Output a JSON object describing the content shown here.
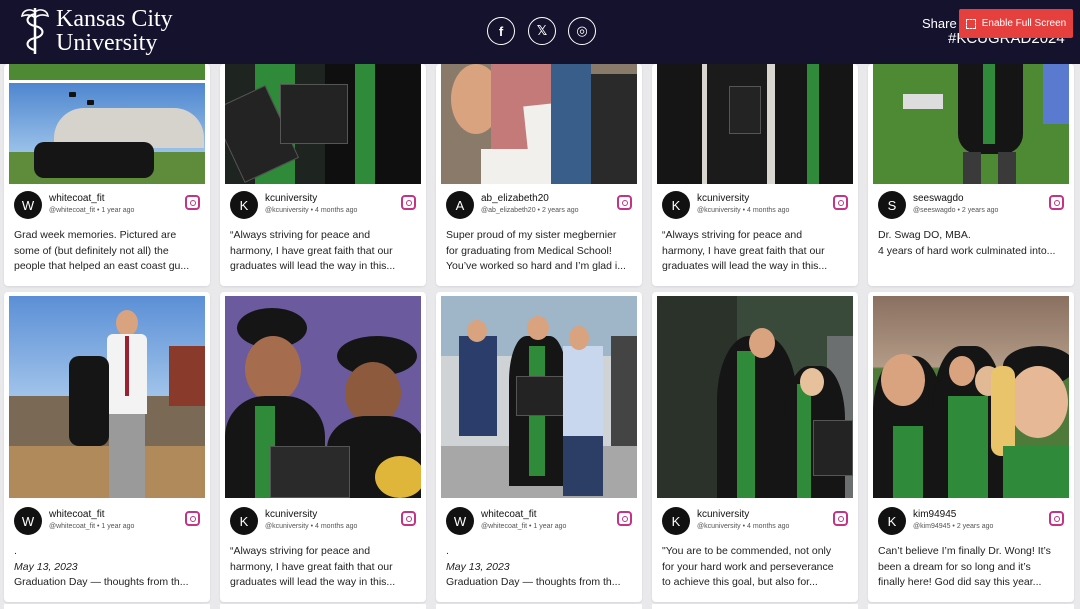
{
  "header": {
    "logo_line1": "Kansas City",
    "logo_line2": "University",
    "share_text": "Share y",
    "hashtag": "#KCUGRAD2024",
    "fullscreen_label": "Enable Full Screen",
    "social": [
      {
        "name": "facebook",
        "glyph": "f"
      },
      {
        "name": "x",
        "glyph": "𝕏"
      },
      {
        "name": "instagram",
        "glyph": "◎"
      }
    ]
  },
  "colors": {
    "header_bg": "#15122d",
    "fullscreen_btn": "#e5403e",
    "instagram": "#c13584"
  },
  "cards": [
    {
      "initial": "W",
      "username": "whitecoat_fit",
      "handle": "@whitecoat_fit",
      "time": "1 year ago",
      "caption": [
        "Grad week memories. Pictured are",
        "some of (but definitely not all) the",
        "people that helped an east coast gu..."
      ]
    },
    {
      "initial": "K",
      "username": "kcuniversity",
      "handle": "@kcuniversity",
      "time": "4 months ago",
      "caption": [
        "“Always striving for peace and",
        "harmony, I have great faith that our",
        "graduates will lead the way in this..."
      ]
    },
    {
      "initial": "A",
      "username": "ab_elizabeth20",
      "handle": "@ab_elizabeth20",
      "time": "2 years ago",
      "caption": [
        "Super proud of my sister megbernier",
        "for graduating from Medical School!",
        "You’ve worked so hard and I’m glad i..."
      ]
    },
    {
      "initial": "K",
      "username": "kcuniversity",
      "handle": "@kcuniversity",
      "time": "4 months ago",
      "caption": [
        "“Always striving for peace and",
        "harmony, I have great faith that our",
        "graduates will lead the way in this..."
      ]
    },
    {
      "initial": "S",
      "username": "seeswagdo",
      "handle": "@seeswagdo",
      "time": "2 years ago",
      "caption": [
        "Dr. Swag DO, MBA.",
        "",
        "4 years of hard work culminated into..."
      ]
    },
    {
      "initial": "W",
      "username": "whitecoat_fit",
      "handle": "@whitecoat_fit",
      "time": "1 year ago",
      "caption": [
        ".",
        "May 13, 2023",
        "Graduation Day — thoughts from th..."
      ]
    },
    {
      "initial": "K",
      "username": "kcuniversity",
      "handle": "@kcuniversity",
      "time": "4 months ago",
      "caption": [
        "“Always striving for peace and",
        "harmony, I have great faith that our",
        "graduates will lead the way in this..."
      ]
    },
    {
      "initial": "W",
      "username": "whitecoat_fit",
      "handle": "@whitecoat_fit",
      "time": "1 year ago",
      "caption": [
        ".",
        "May 13, 2023",
        "Graduation Day — thoughts from th..."
      ]
    },
    {
      "initial": "K",
      "username": "kcuniversity",
      "handle": "@kcuniversity",
      "time": "4 months ago",
      "caption": [
        "\"You are to be commended, not only",
        "for your hard work and perseverance",
        "to achieve this goal, but also for..."
      ]
    },
    {
      "initial": "K",
      "username": "kim94945",
      "handle": "@kim94945",
      "time": "2 years ago",
      "caption": [
        "Can’t believe I’m finally Dr. Wong! It’s",
        "been a dream for so long and it’s",
        "finally here! God did say this year..."
      ]
    }
  ]
}
